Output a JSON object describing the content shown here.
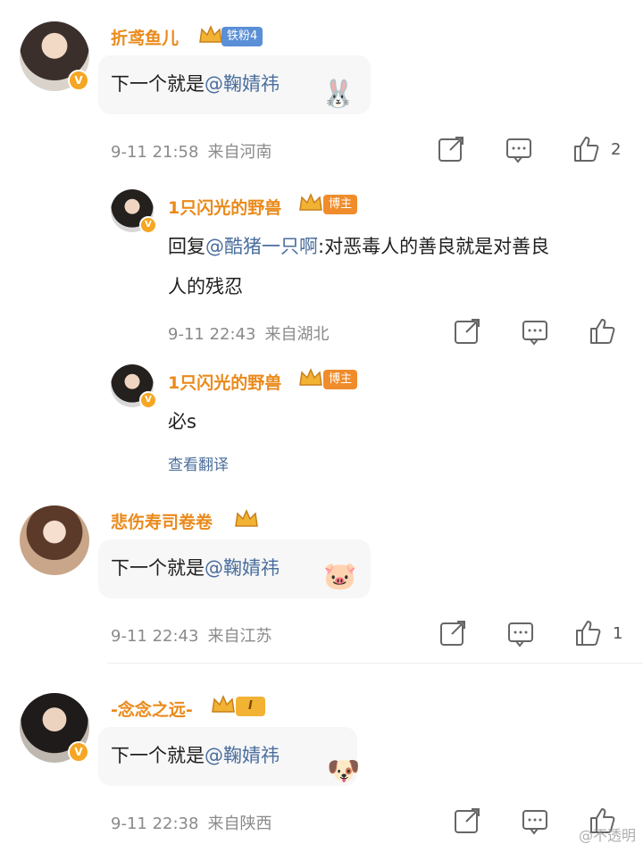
{
  "comments": [
    {
      "name": "折鸢鱼儿",
      "badge": "铁粉4",
      "text_prefix": "下一个就是",
      "mention": "@鞠婧祎",
      "time": "9-11 21:58",
      "location": "来自河南",
      "likes": "2"
    },
    {
      "name": "悲伤寿司卷卷",
      "text_prefix": "下一个就是",
      "mention": "@鞠婧祎",
      "time": "9-11 22:43",
      "location": "来自江苏",
      "likes": "1"
    },
    {
      "name": "-念念之远-",
      "badge": "I",
      "text_prefix": "下一个就是",
      "mention": "@鞠婧祎",
      "time": "9-11 22:38",
      "location": "来自陕西",
      "likes": ""
    }
  ],
  "replies": [
    {
      "name": "1只闪光的野兽",
      "badge": "博主",
      "reply_word": "回复",
      "mention": "@酷猪一只啊",
      "line1": ":对恶毒人的善良就是对善良",
      "line2": "人的残忍",
      "time": "9-11 22:43",
      "location": "来自湖北"
    },
    {
      "name": "1只闪光的野兽",
      "badge": "博主",
      "text": "必s",
      "translate": "查看翻译"
    }
  ],
  "watermark": "@不透明",
  "colors": {
    "name": "#ea8a1b",
    "mention": "#4a6e9d",
    "badge_blue": "#5b8fd6",
    "badge_orange": "#f08c2b"
  }
}
